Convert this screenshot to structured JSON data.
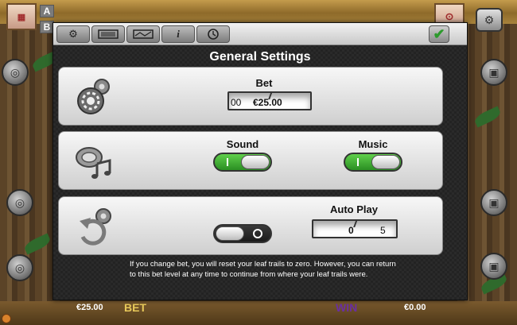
{
  "game": {
    "ab_labels": [
      "A",
      "B"
    ],
    "bottom_bar": {
      "bet_value": "€25.00",
      "bet_label": "BET",
      "win_label": "WIN",
      "win_value": "€0.00"
    }
  },
  "settings": {
    "title": "General Settings",
    "tabs": [
      {
        "icon": "gear-icon"
      },
      {
        "icon": "paytable-icon"
      },
      {
        "icon": "lines-icon"
      },
      {
        "icon": "info-icon",
        "glyph": "i"
      },
      {
        "icon": "history-icon"
      }
    ],
    "close_icon": "checkmark-icon",
    "bet": {
      "label": "Bet",
      "prev_value_fragment": "00",
      "value": "€25.00"
    },
    "sound": {
      "label": "Sound",
      "state": "on",
      "on_glyph": "I"
    },
    "music": {
      "label": "Music",
      "state": "on",
      "on_glyph": "I"
    },
    "autoplay_toggle": {
      "state": "off"
    },
    "autoplay": {
      "label": "Auto Play",
      "value": "0",
      "next_value": "5"
    },
    "note": "If you change bet, you will reset your leaf trails to zero. However, you can return to this bet level at any time to continue from where your leaf trails were."
  },
  "colors": {
    "toggle_on": "#2b8f23",
    "toggle_off": "#1a1a1a",
    "check": "#2c9a2c"
  }
}
